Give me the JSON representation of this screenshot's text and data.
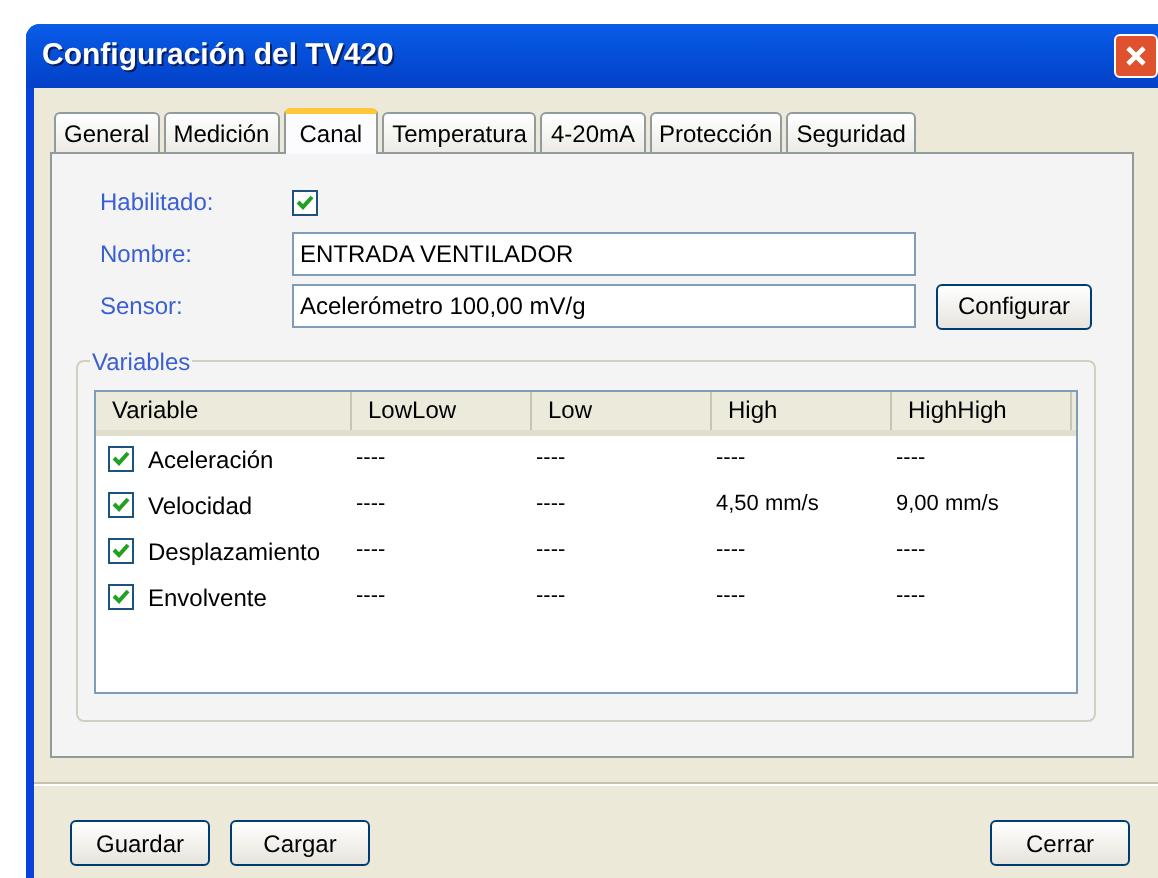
{
  "window": {
    "title": "Configuración del TV420"
  },
  "tabs": [
    {
      "label": "General",
      "selected": false
    },
    {
      "label": "Medición",
      "selected": false
    },
    {
      "label": "Canal",
      "selected": true
    },
    {
      "label": "Temperatura",
      "selected": false
    },
    {
      "label": "4-20mA",
      "selected": false
    },
    {
      "label": "Protección",
      "selected": false
    },
    {
      "label": "Seguridad",
      "selected": false
    }
  ],
  "enabled": {
    "label": "Habilitado:",
    "checked": true
  },
  "name": {
    "label": "Nombre:",
    "value": "ENTRADA VENTILADOR"
  },
  "sensor": {
    "label": "Sensor:",
    "value": "Acelerómetro 100,00 mV/g",
    "button": "Configurar"
  },
  "variables": {
    "title": "Variables",
    "columns": [
      "Variable",
      "LowLow",
      "Low",
      "High",
      "HighHigh"
    ],
    "rows": [
      {
        "name": "Aceleración",
        "checked": true,
        "cells": [
          "----",
          "----",
          "----",
          "----"
        ]
      },
      {
        "name": "Velocidad",
        "checked": true,
        "cells": [
          "----",
          "----",
          "4,50 mm/s",
          "9,00 mm/s"
        ]
      },
      {
        "name": "Desplazamiento",
        "checked": true,
        "cells": [
          "----",
          "----",
          "----",
          "----"
        ]
      },
      {
        "name": "Envolvente",
        "checked": true,
        "cells": [
          "----",
          "----",
          "----",
          "----"
        ]
      }
    ]
  },
  "buttons": {
    "left": [
      "Guardar",
      "Cargar"
    ],
    "right": [
      "Cerrar"
    ]
  }
}
